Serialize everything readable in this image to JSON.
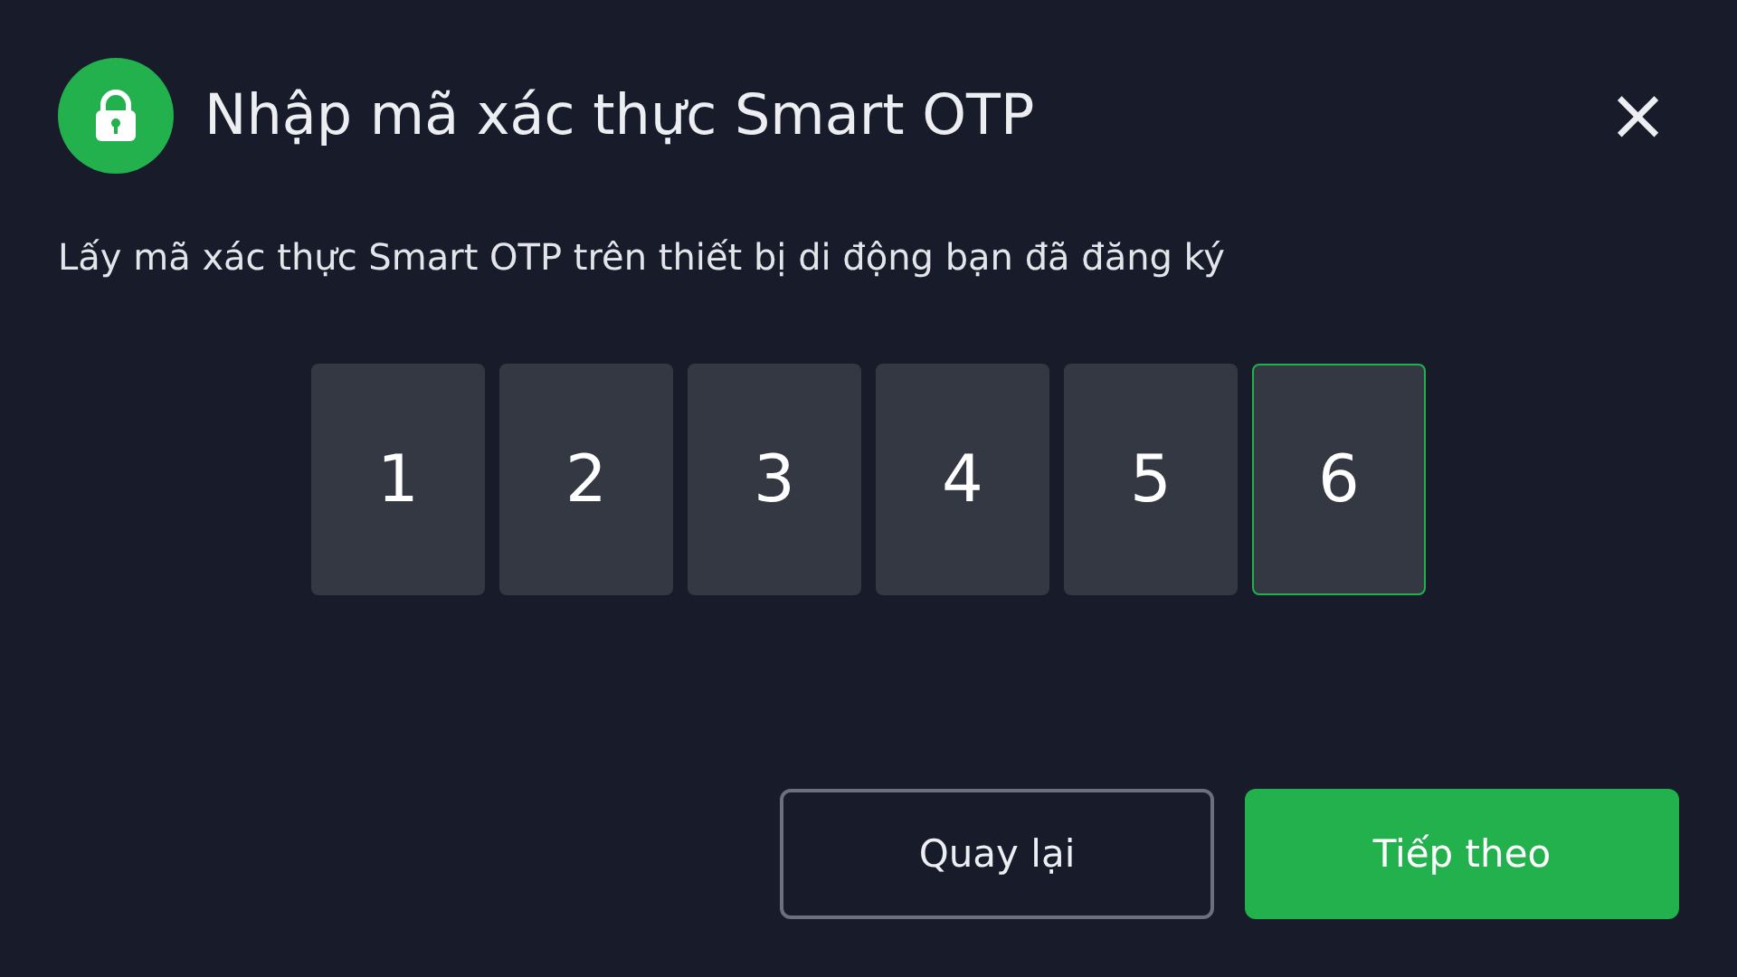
{
  "dialog": {
    "title": "Nhập mã xác thực Smart OTP",
    "close": "×",
    "instruction": "Lấy mã xác thực Smart OTP trên thiết bị di động bạn đã đăng ký"
  },
  "otp_digits": [
    {
      "value": "1",
      "focused": false
    },
    {
      "value": "2",
      "focused": false
    },
    {
      "value": "3",
      "focused": false
    },
    {
      "value": "4",
      "focused": false
    },
    {
      "value": "5",
      "focused": false
    },
    {
      "value": "6",
      "focused": true
    }
  ],
  "buttons": [
    {
      "label": "Quay lại",
      "kind": "secondary"
    },
    {
      "label": "Tiếp theo",
      "kind": "primary"
    }
  ]
}
